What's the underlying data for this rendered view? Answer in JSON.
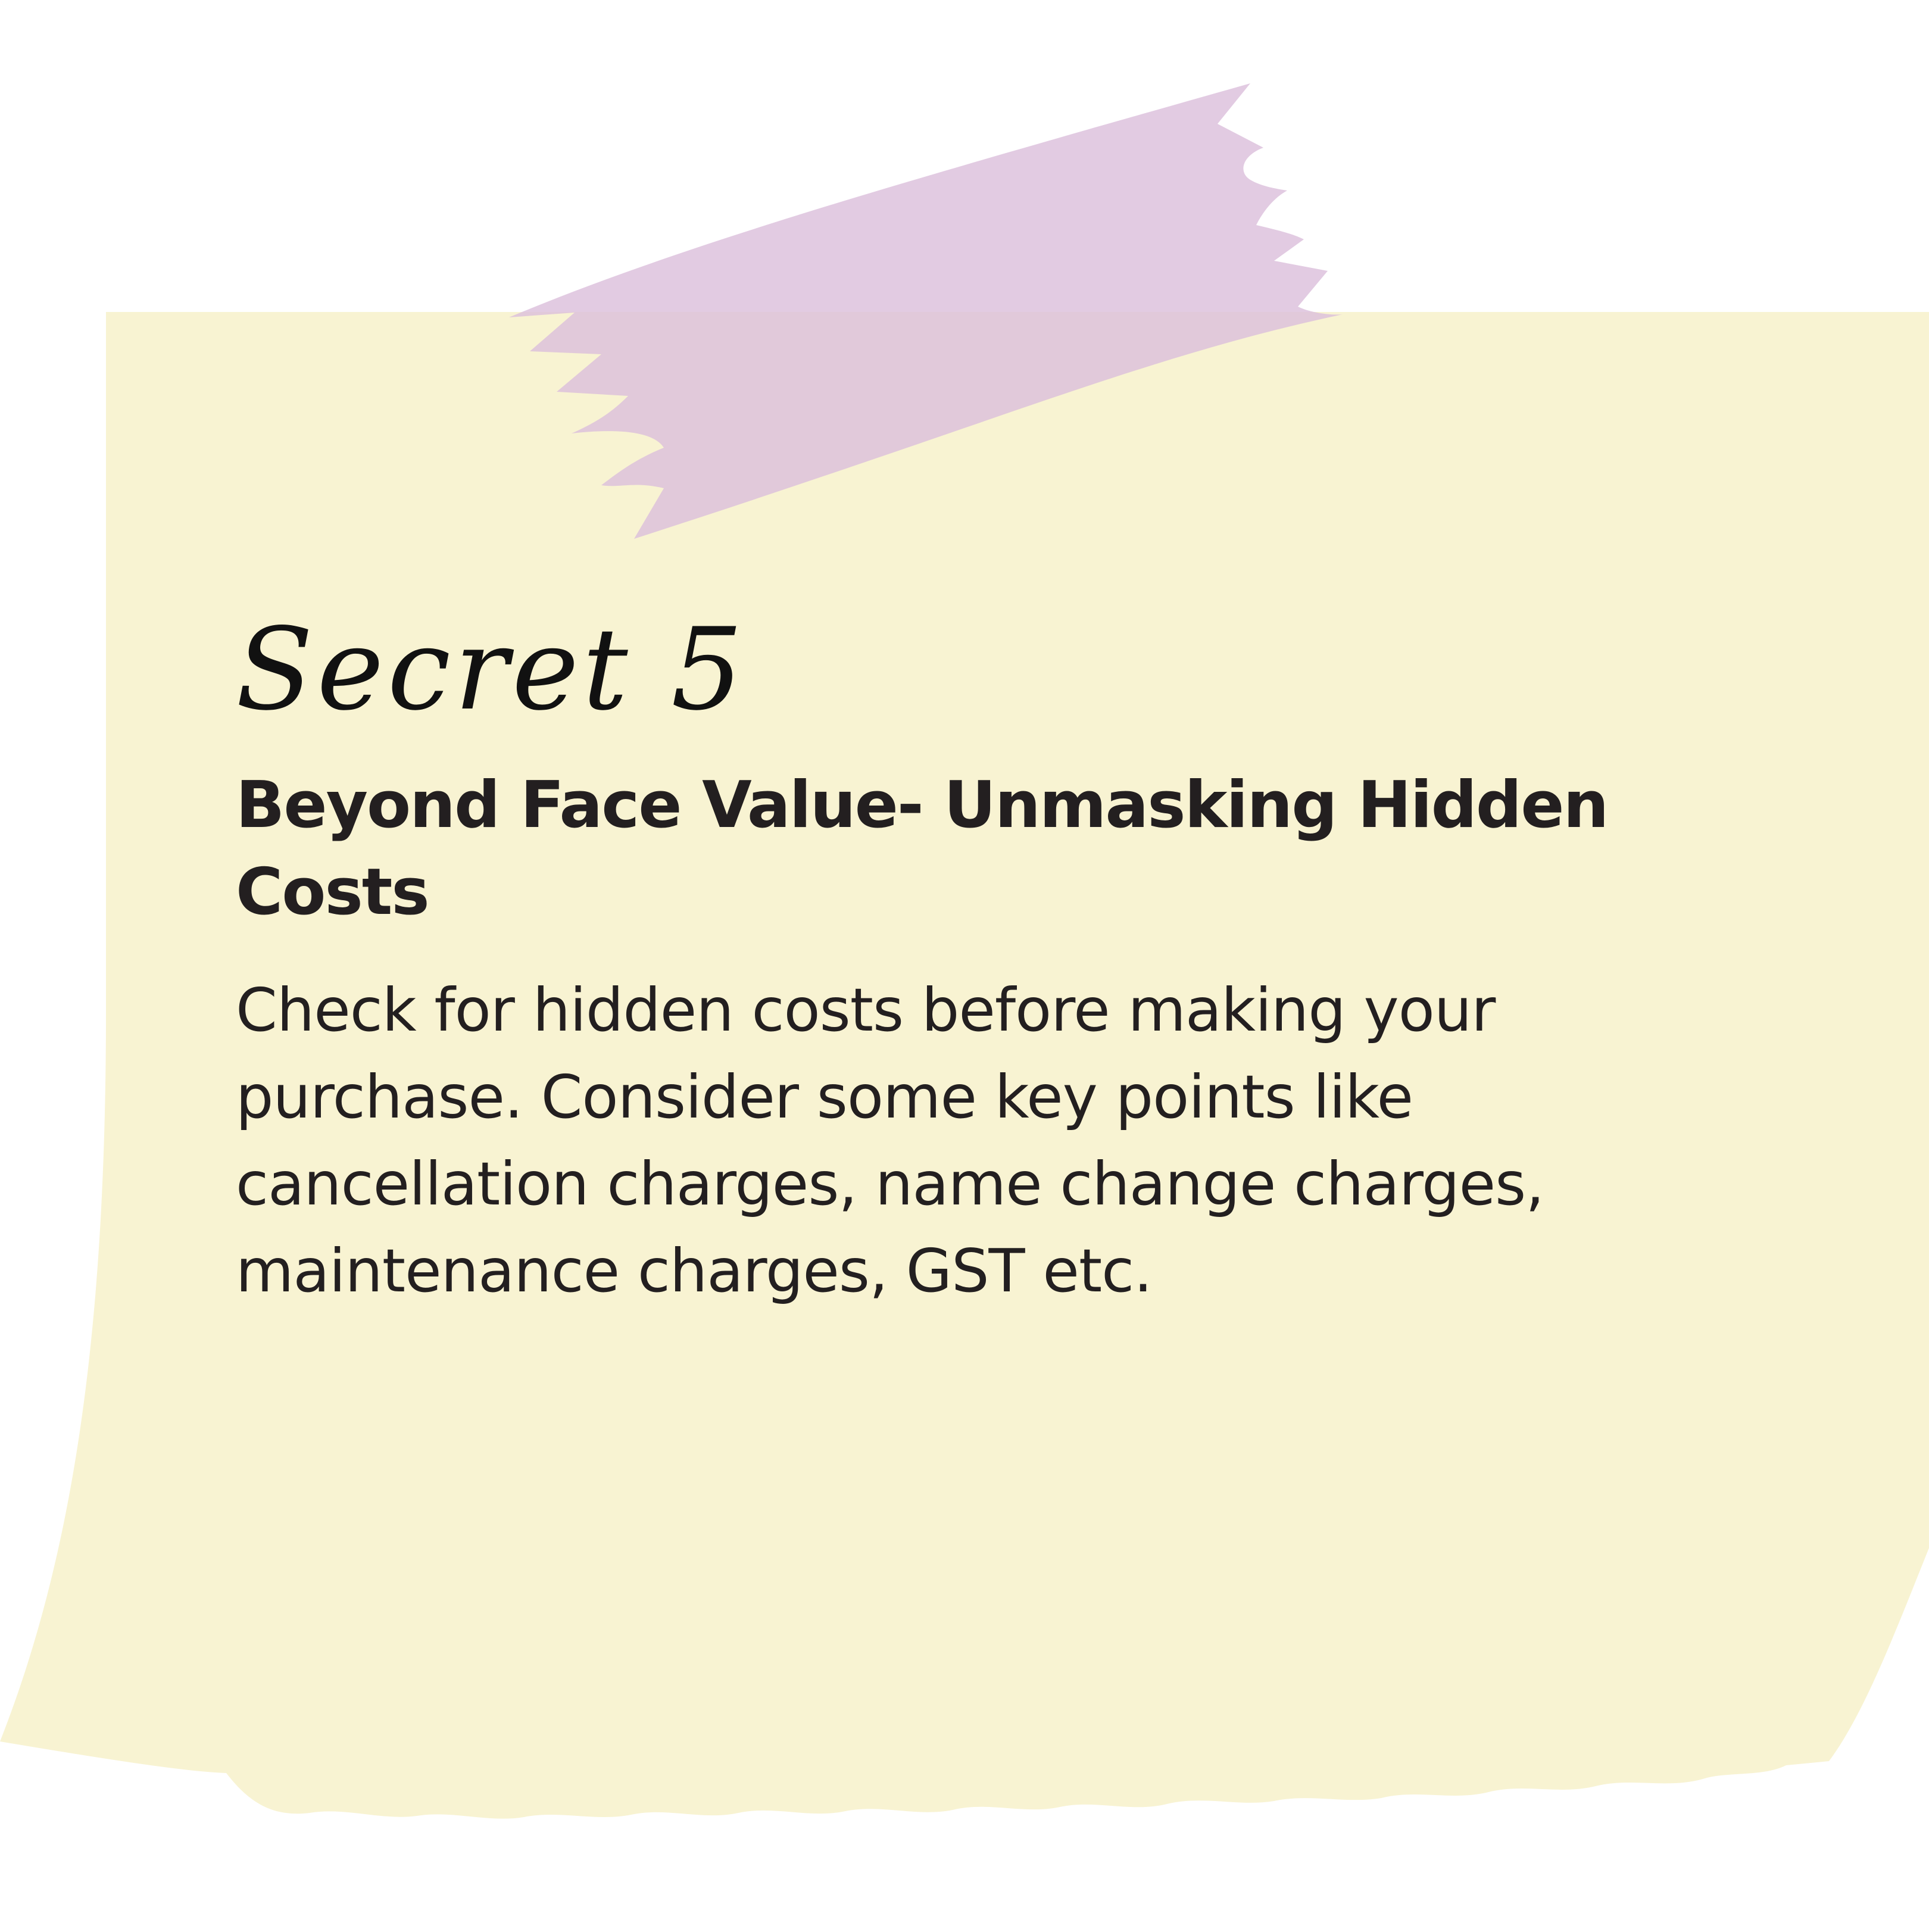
{
  "note": {
    "secret_label": "Secret 5",
    "heading": "Beyond Face Value- Unmasking Hidden Costs",
    "body": "Check for hidden costs before making your purchase. Consider some key points like cancellation charges, name change charges, maintenance charges, GST etc."
  },
  "colors": {
    "paper": "#f8f3d2",
    "tape": "#e3cde0",
    "text": "#231f20"
  }
}
